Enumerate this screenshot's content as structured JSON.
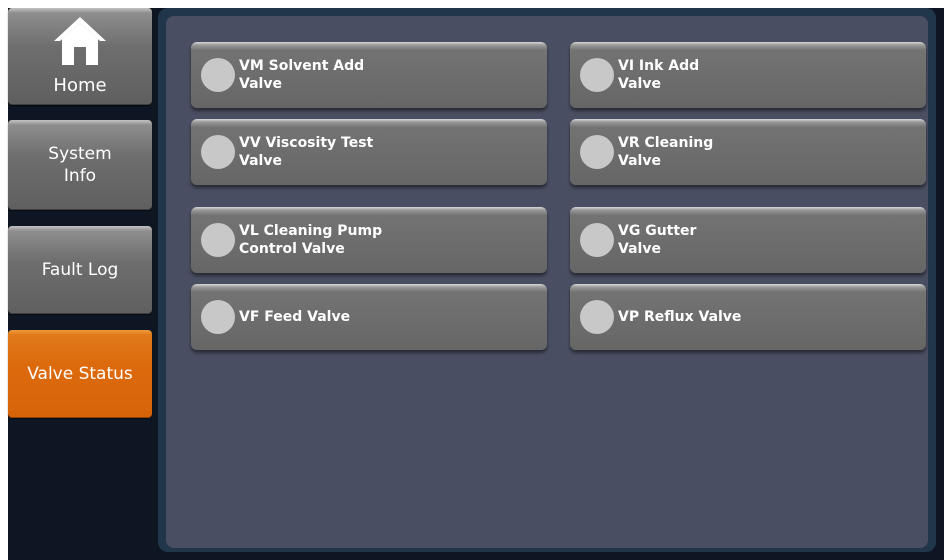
{
  "nav": {
    "home": {
      "label": "Home",
      "icon": "home-icon"
    },
    "system_info": {
      "label": "System\nInfo"
    },
    "fault_log": {
      "label": "Fault Log"
    },
    "valve_status": {
      "label": "Valve Status",
      "active": true
    }
  },
  "valves": [
    {
      "label": "VM Solvent Add\nValve",
      "state": "off"
    },
    {
      "label": "VI Ink Add\nValve",
      "state": "off"
    },
    {
      "label": "VV Viscosity Test\nValve",
      "state": "off"
    },
    {
      "label": "VR Cleaning\nValve",
      "state": "off"
    },
    {
      "label": "VL Cleaning Pump\nControl Valve",
      "state": "off"
    },
    {
      "label": "VG Gutter\nValve",
      "state": "off"
    },
    {
      "label": "VF Feed Valve",
      "state": "off"
    },
    {
      "label": "VP Reflux Valve",
      "state": "off"
    }
  ],
  "colors": {
    "active_nav": "#dc6a0c",
    "panel_background": "#4a4e62",
    "indicator_off": "#c8c8c8"
  }
}
